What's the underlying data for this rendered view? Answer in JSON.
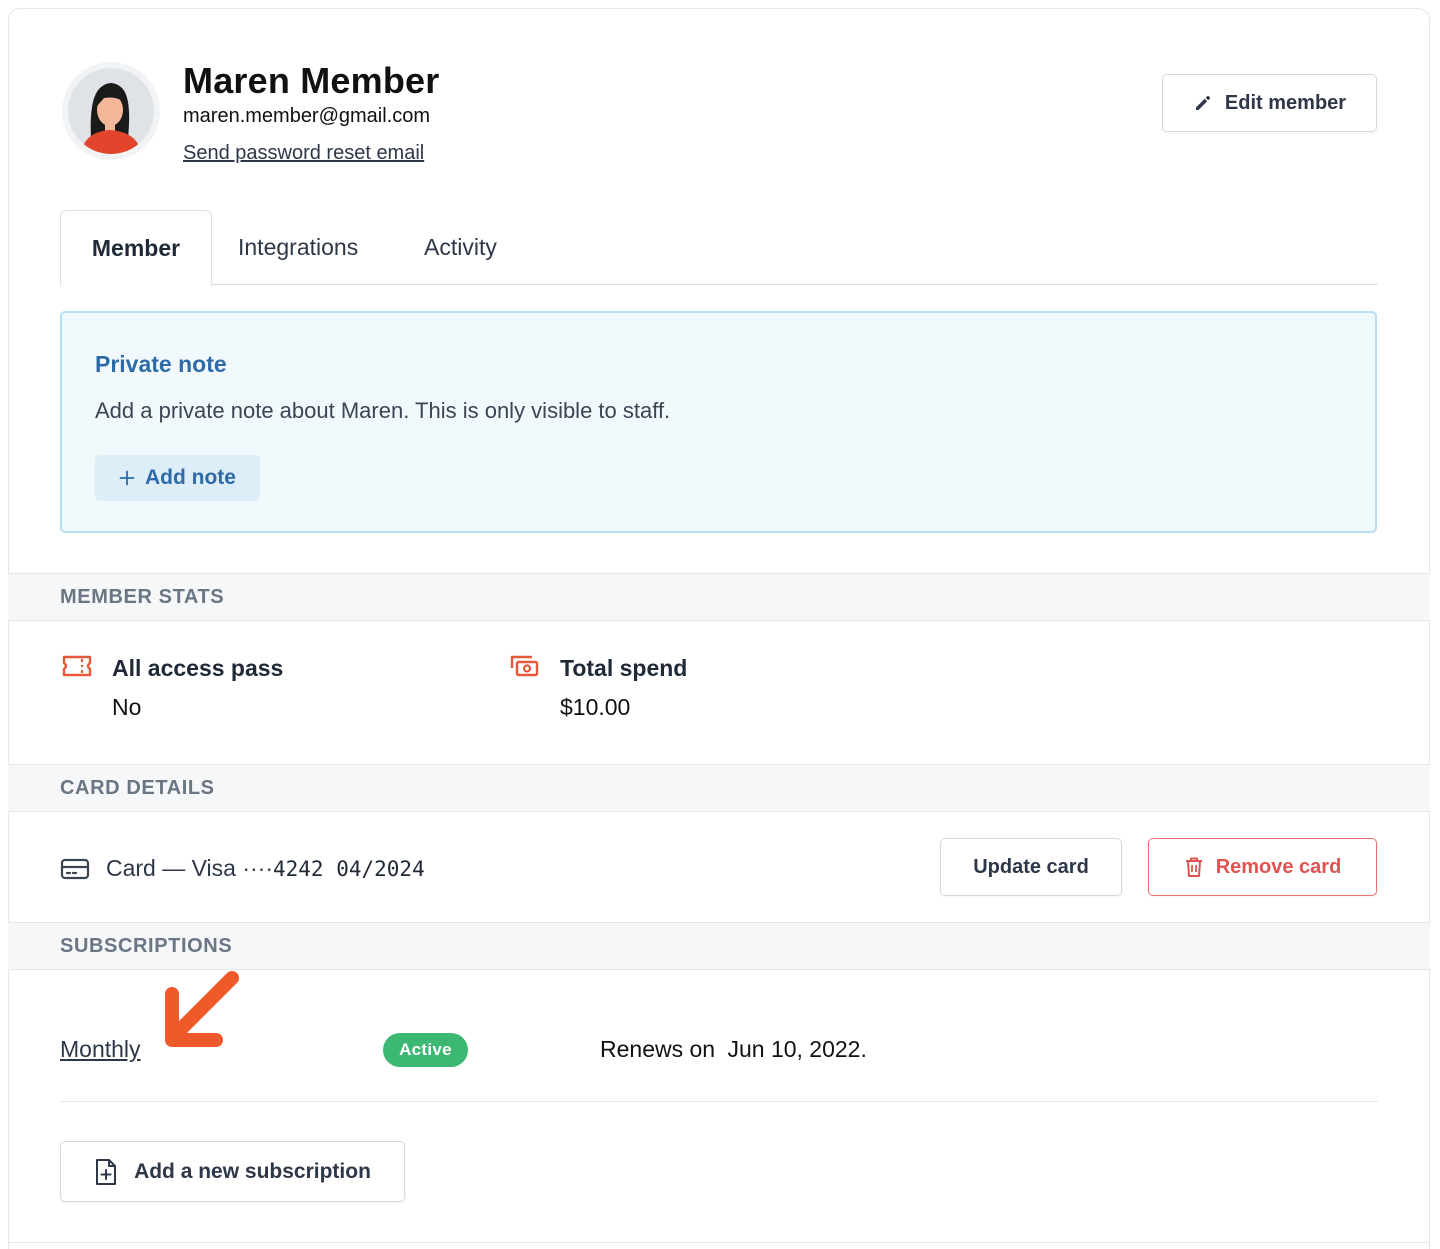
{
  "member": {
    "name": "Maren Member",
    "email": "maren.member@gmail.com",
    "reset_link": "Send password reset email",
    "edit_label": "Edit member"
  },
  "tabs": [
    {
      "label": "Member",
      "active": true
    },
    {
      "label": "Integrations",
      "active": false
    },
    {
      "label": "Activity",
      "active": false
    }
  ],
  "private_note": {
    "title": "Private note",
    "text": "Add a private note about Maren. This is only visible to staff.",
    "button": "Add note"
  },
  "member_stats": {
    "heading": "MEMBER STATS",
    "items": [
      {
        "label": "All access pass",
        "value": "No",
        "icon": "ticket-icon"
      },
      {
        "label": "Total spend",
        "value": "$10.00",
        "icon": "cash-icon"
      }
    ]
  },
  "card_details": {
    "heading": "CARD DETAILS",
    "label": "Card — Visa ····",
    "number": "4242 04/2024",
    "update_label": "Update card",
    "remove_label": "Remove card"
  },
  "subscriptions": {
    "heading": "SUBSCRIPTIONS",
    "items": [
      {
        "name": "Monthly",
        "status": "Active",
        "renews_label": "Renews on",
        "renews_date": "Jun 10, 2022."
      }
    ],
    "add_label": "Add a new subscription"
  },
  "colors": {
    "accent_blue": "#2c6aa8",
    "active_green": "#3cb873",
    "danger_red": "#e05450",
    "icon_orange": "#e5583a"
  }
}
